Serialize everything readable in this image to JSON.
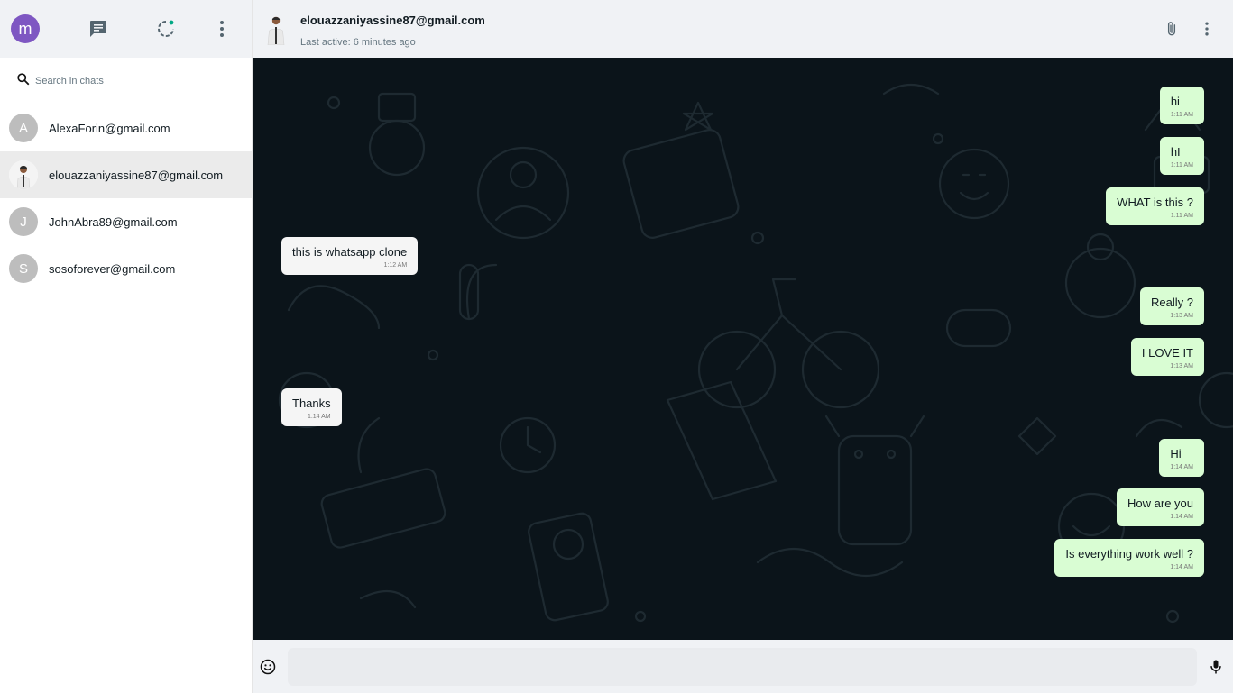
{
  "user": {
    "initial": "m",
    "avatar_color": "#7e57c2"
  },
  "sidebar_header": {
    "icons": [
      "chat-icon",
      "status-icon",
      "more-vert-icon"
    ]
  },
  "search": {
    "placeholder": "Search in chats"
  },
  "chats": [
    {
      "initial": "A",
      "name": "AlexaForin@gmail.com",
      "active": false
    },
    {
      "initial": "",
      "name": "elouazzaniyassine87@gmail.com",
      "active": true,
      "photo": true
    },
    {
      "initial": "J",
      "name": "JohnAbra89@gmail.com",
      "active": false
    },
    {
      "initial": "S",
      "name": "sosoforever@gmail.com",
      "active": false
    }
  ],
  "conversation": {
    "contact_name": "elouazzaniyassine87@gmail.com",
    "status": "Last active: 6 minutes ago",
    "header_icons": [
      "attach-icon",
      "more-vert-icon"
    ]
  },
  "messages": [
    {
      "dir": "out",
      "text": "hi",
      "time": "1:11 AM"
    },
    {
      "dir": "out",
      "text": "hI",
      "time": "1:11 AM"
    },
    {
      "dir": "out",
      "text": "WHAT is this ?",
      "time": "1:11 AM"
    },
    {
      "dir": "in",
      "text": "this is whatsapp clone",
      "time": "1:12 AM"
    },
    {
      "dir": "out",
      "text": "Really ?",
      "time": "1:13 AM"
    },
    {
      "dir": "out",
      "text": "I LOVE IT",
      "time": "1:13 AM"
    },
    {
      "dir": "in",
      "text": "Thanks",
      "time": "1:14 AM"
    },
    {
      "dir": "out",
      "text": "Hi",
      "time": "1:14 AM"
    },
    {
      "dir": "out",
      "text": "How are you",
      "time": "1:14 AM"
    },
    {
      "dir": "out",
      "text": "Is everything work well ?",
      "time": "1:14 AM"
    }
  ],
  "composer": {
    "value": "",
    "icons": [
      "emoji-icon",
      "mic-icon"
    ]
  },
  "colors": {
    "chat_bg": "#0b141a",
    "outgoing_bubble": "#d9fdd3",
    "incoming_bubble": "#f5f5f5",
    "header_bg": "#f0f2f5"
  }
}
